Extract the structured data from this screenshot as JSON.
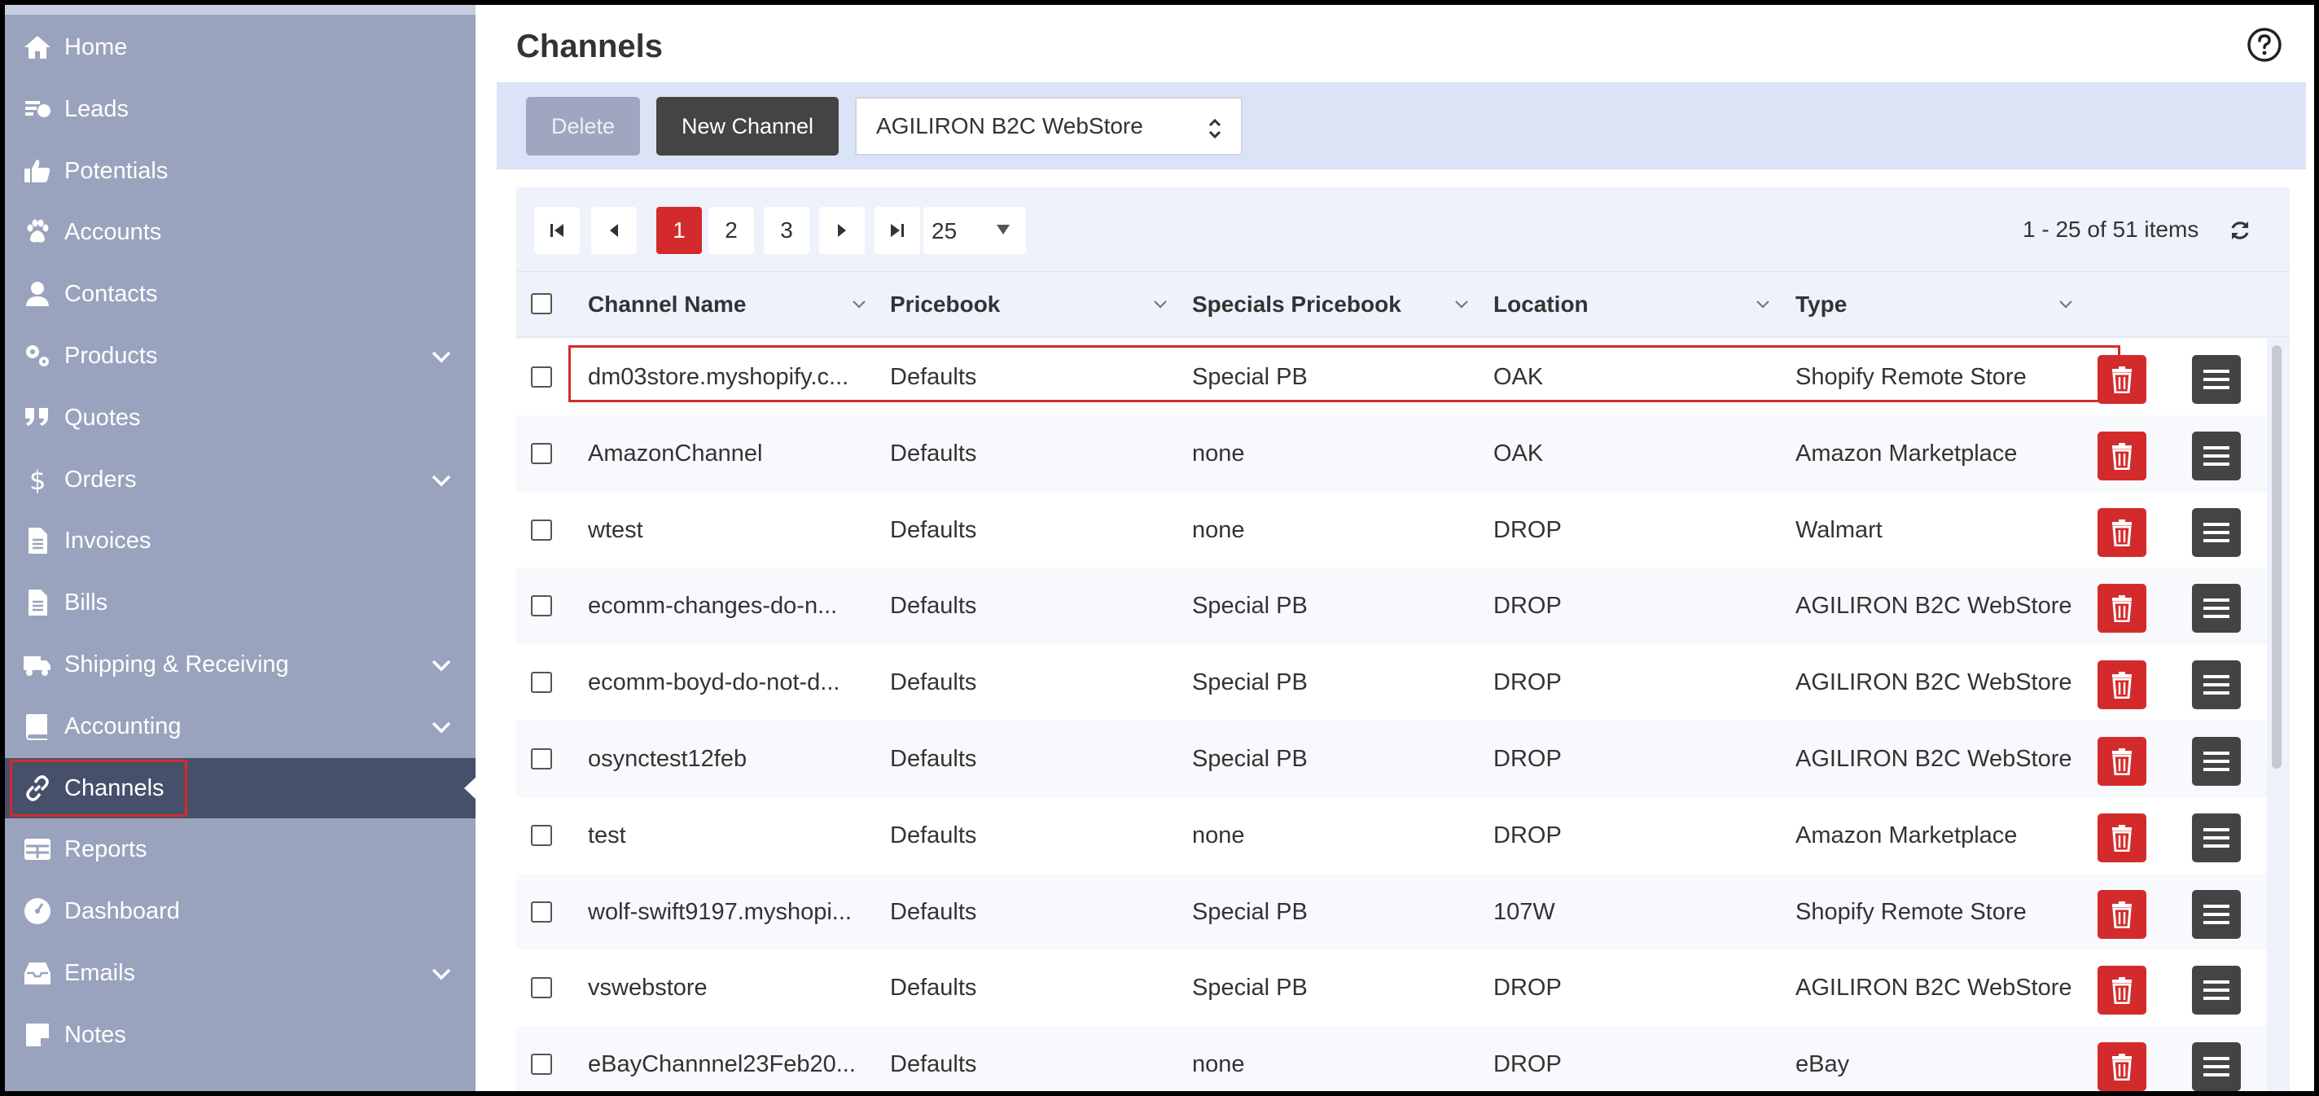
{
  "sidebar": {
    "items": [
      {
        "label": "Home",
        "icon": "home-icon"
      },
      {
        "label": "Leads",
        "icon": "leads-icon"
      },
      {
        "label": "Potentials",
        "icon": "thumbs-up-icon"
      },
      {
        "label": "Accounts",
        "icon": "paw-icon"
      },
      {
        "label": "Contacts",
        "icon": "user-icon"
      },
      {
        "label": "Products",
        "icon": "gears-icon",
        "expandable": true
      },
      {
        "label": "Quotes",
        "icon": "quote-icon"
      },
      {
        "label": "Orders",
        "icon": "dollar-icon",
        "expandable": true
      },
      {
        "label": "Invoices",
        "icon": "file-icon"
      },
      {
        "label": "Bills",
        "icon": "file-icon"
      },
      {
        "label": "Shipping & Receiving",
        "icon": "truck-icon",
        "expandable": true
      },
      {
        "label": "Accounting",
        "icon": "book-icon",
        "expandable": true
      },
      {
        "label": "Channels",
        "icon": "link-icon",
        "active": true
      },
      {
        "label": "Reports",
        "icon": "table-icon"
      },
      {
        "label": "Dashboard",
        "icon": "gauge-icon"
      },
      {
        "label": "Emails",
        "icon": "inbox-icon",
        "expandable": true
      },
      {
        "label": "Notes",
        "icon": "note-icon"
      }
    ]
  },
  "header": {
    "title": "Channels"
  },
  "toolbar": {
    "delete_label": "Delete",
    "new_label": "New Channel",
    "channel_select_value": "AGILIRON B2C WebStore"
  },
  "pager": {
    "pages": [
      "1",
      "2",
      "3"
    ],
    "current": "1",
    "page_size": "25",
    "info": "1 - 25 of 51 items"
  },
  "table": {
    "columns": [
      "Channel Name",
      "Pricebook",
      "Specials Pricebook",
      "Location",
      "Type"
    ],
    "rows": [
      {
        "name": "dm03store.myshopify.c...",
        "pricebook": "Defaults",
        "specials": "Special PB",
        "location": "OAK",
        "type": "Shopify Remote Store"
      },
      {
        "name": "AmazonChannel",
        "pricebook": "Defaults",
        "specials": "none",
        "location": "OAK",
        "type": "Amazon Marketplace"
      },
      {
        "name": "wtest",
        "pricebook": "Defaults",
        "specials": "none",
        "location": "DROP",
        "type": "Walmart"
      },
      {
        "name": "ecomm-changes-do-n...",
        "pricebook": "Defaults",
        "specials": "Special PB",
        "location": "DROP",
        "type": "AGILIRON B2C WebStore"
      },
      {
        "name": "ecomm-boyd-do-not-d...",
        "pricebook": "Defaults",
        "specials": "Special PB",
        "location": "DROP",
        "type": "AGILIRON B2C WebStore"
      },
      {
        "name": "osynctest12feb",
        "pricebook": "Defaults",
        "specials": "Special PB",
        "location": "DROP",
        "type": "AGILIRON B2C WebStore"
      },
      {
        "name": "test",
        "pricebook": "Defaults",
        "specials": "none",
        "location": "DROP",
        "type": "Amazon Marketplace"
      },
      {
        "name": "wolf-swift9197.myshopi...",
        "pricebook": "Defaults",
        "specials": "Special PB",
        "location": "107W",
        "type": "Shopify Remote Store"
      },
      {
        "name": "vswebstore",
        "pricebook": "Defaults",
        "specials": "Special PB",
        "location": "DROP",
        "type": "AGILIRON B2C WebStore"
      },
      {
        "name": "eBayChannnel23Feb20...",
        "pricebook": "Defaults",
        "specials": "none",
        "location": "DROP",
        "type": "eBay"
      }
    ]
  },
  "colors": {
    "accent": "#d32b2b",
    "sidebar": "#99a3bd",
    "sidebar_active": "#46506a",
    "toolbar": "#dbe3f7"
  }
}
